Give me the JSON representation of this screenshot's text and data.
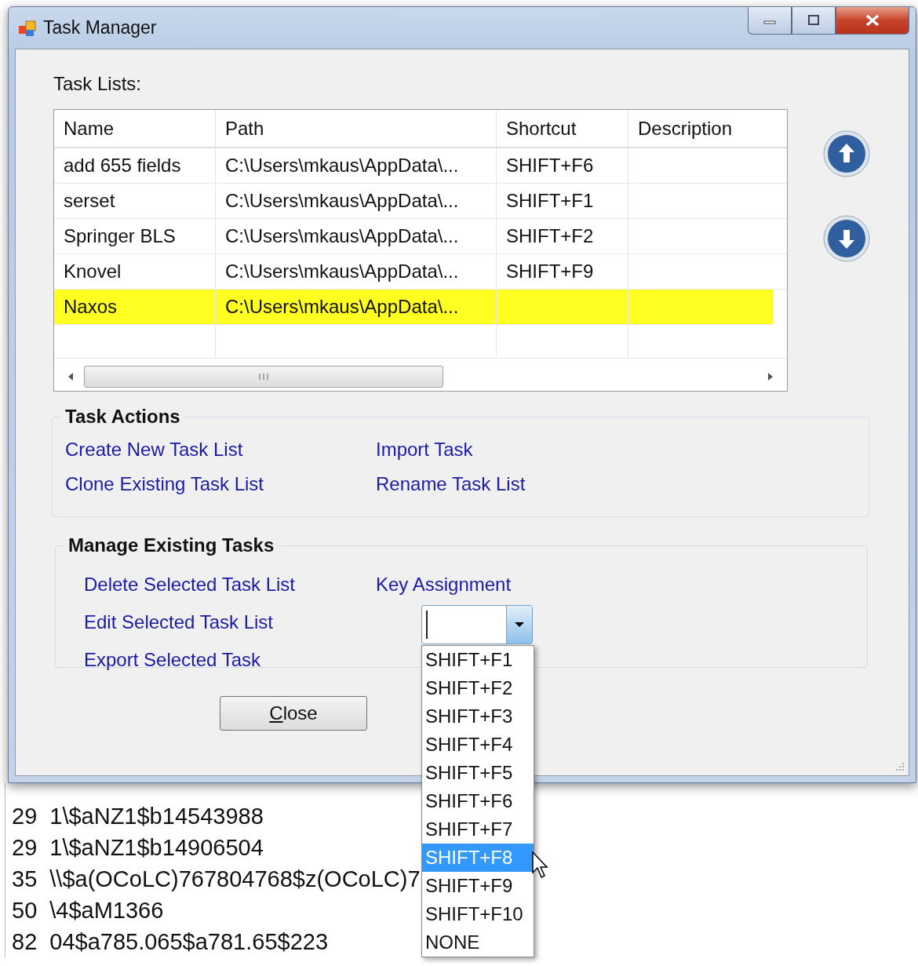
{
  "window": {
    "title": "Task Manager"
  },
  "task_lists_label": "Task Lists:",
  "table": {
    "columns": [
      "Name",
      "Path",
      "Shortcut",
      "Description"
    ],
    "rows": [
      {
        "cells": [
          "add 655 fields",
          "C:\\Users\\mkaus\\AppData\\...",
          "SHIFT+F6",
          ""
        ],
        "selected": false
      },
      {
        "cells": [
          "serset",
          "C:\\Users\\mkaus\\AppData\\...",
          "SHIFT+F1",
          ""
        ],
        "selected": false
      },
      {
        "cells": [
          "Springer BLS",
          "C:\\Users\\mkaus\\AppData\\...",
          "SHIFT+F2",
          ""
        ],
        "selected": false
      },
      {
        "cells": [
          "Knovel",
          "C:\\Users\\mkaus\\AppData\\...",
          "SHIFT+F9",
          ""
        ],
        "selected": false
      },
      {
        "cells": [
          "Naxos",
          "C:\\Users\\mkaus\\AppData\\...",
          "",
          ""
        ],
        "selected": true
      }
    ]
  },
  "task_actions": {
    "title": "Task Actions",
    "links": [
      "Create New Task List",
      "Import Task",
      "Clone Existing Task List",
      "Rename Task List"
    ]
  },
  "manage_tasks": {
    "title": "Manage Existing Tasks",
    "links": [
      "Delete Selected Task List",
      "Edit Selected Task List",
      "Export Selected Task"
    ],
    "key_assignment_label": "Key Assignment",
    "dropdown": {
      "items": [
        {
          "label": "SHIFT+F1",
          "selected": false
        },
        {
          "label": "SHIFT+F2",
          "selected": false
        },
        {
          "label": "SHIFT+F3",
          "selected": false
        },
        {
          "label": "SHIFT+F4",
          "selected": false
        },
        {
          "label": "SHIFT+F5",
          "selected": false
        },
        {
          "label": "SHIFT+F6",
          "selected": false
        },
        {
          "label": "SHIFT+F7",
          "selected": false
        },
        {
          "label": "SHIFT+F8",
          "selected": true
        },
        {
          "label": "SHIFT+F9",
          "selected": false
        },
        {
          "label": "SHIFT+F10",
          "selected": false
        },
        {
          "label": "NONE",
          "selected": false
        }
      ]
    }
  },
  "close_button": "Close",
  "background_lines": [
    {
      "tag": "29",
      "text": "1\\$aNZ1$b14543988"
    },
    {
      "tag": "29",
      "text": "1\\$aNZ1$b14906504"
    },
    {
      "tag": "35",
      "text": "\\\\$a(OCoLC)767804768$z(OCoLC)7"
    },
    {
      "tag": "50",
      "text": "\\4$aM1366"
    },
    {
      "tag": "82",
      "text": "04$a785.065$a781.65$223"
    }
  ]
}
